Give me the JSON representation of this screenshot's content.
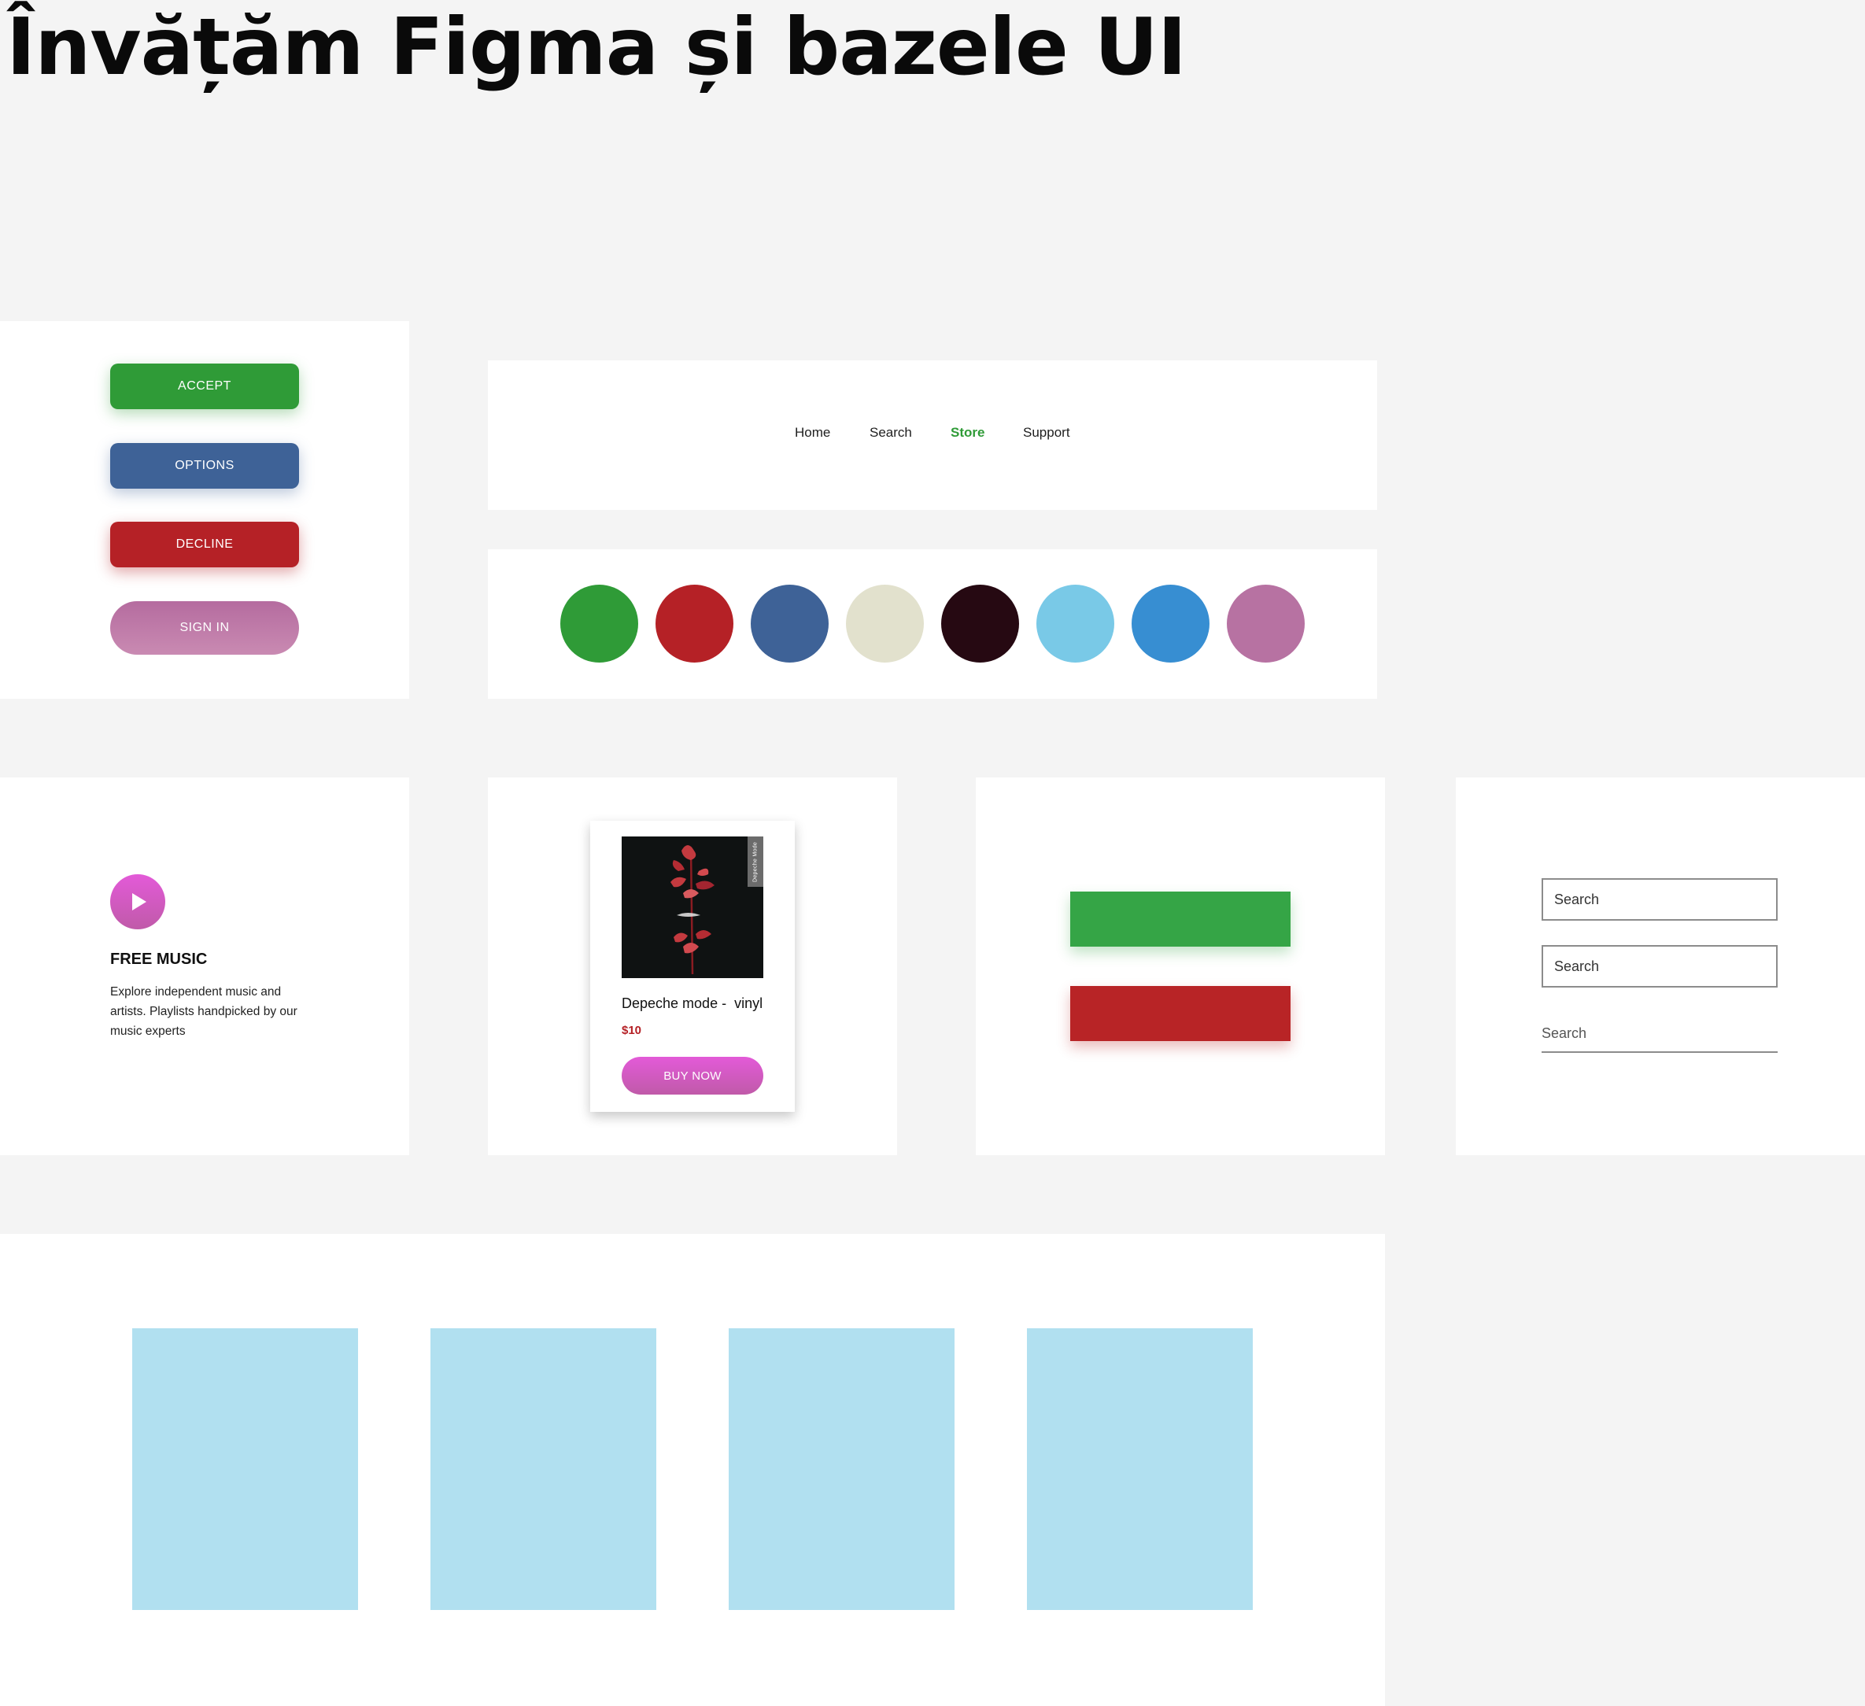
{
  "title": "Învățăm Figma și bazele UI",
  "buttons": {
    "accept": "ACCEPT",
    "options": "OPTIONS",
    "decline": "DECLINE",
    "sign_in": "SIGN IN"
  },
  "nav": {
    "items": [
      {
        "label": "Home"
      },
      {
        "label": "Search"
      },
      {
        "label": "Store"
      },
      {
        "label": "Support"
      }
    ],
    "active_item": "Store",
    "active_color": "#2f9b37"
  },
  "palette": [
    "#2f9b37",
    "#b52126",
    "#3e6297",
    "#e2e1cd",
    "#260912",
    "#79c9e7",
    "#378ed2",
    "#b772a2"
  ],
  "free_music": {
    "title": "FREE MUSIC",
    "description": "Explore independent music and artists. Playlists handpicked by our music experts"
  },
  "product": {
    "album_spine": "Depeche Mode",
    "name": "Depeche mode -  vinyl",
    "price": "$10",
    "buy_label": "BUY NOW"
  },
  "bars": {
    "green": "#35a546",
    "red": "#b82426"
  },
  "search": {
    "fields": [
      {
        "placeholder": "Search"
      },
      {
        "placeholder": "Search"
      },
      {
        "placeholder": "Search"
      }
    ]
  },
  "tiles": {
    "color": "#b1e0f0",
    "count": 4
  }
}
